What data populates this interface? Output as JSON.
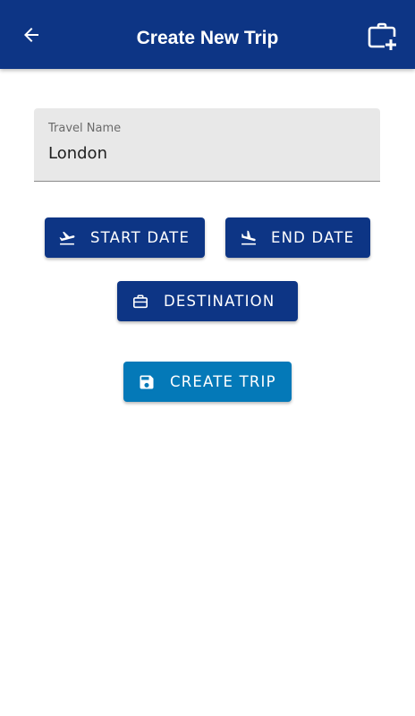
{
  "app_bar": {
    "title": "Create New Trip",
    "back_icon": "arrow-back-icon",
    "action_icon": "briefcase-add-icon"
  },
  "form": {
    "travel_name": {
      "label": "Travel Name",
      "value": "London"
    }
  },
  "buttons": {
    "start_date": {
      "label": "START DATE",
      "icon": "flight-takeoff-icon"
    },
    "end_date": {
      "label": "END DATE",
      "icon": "flight-land-icon"
    },
    "destination": {
      "label": "DESTINATION",
      "icon": "briefcase-icon"
    },
    "create_trip": {
      "label": "CREATE TRIP",
      "icon": "save-icon"
    }
  },
  "colors": {
    "primary": "#0d3585",
    "accent": "#0479b8",
    "field_background": "#e8e8e8",
    "background": "#ffffff"
  }
}
